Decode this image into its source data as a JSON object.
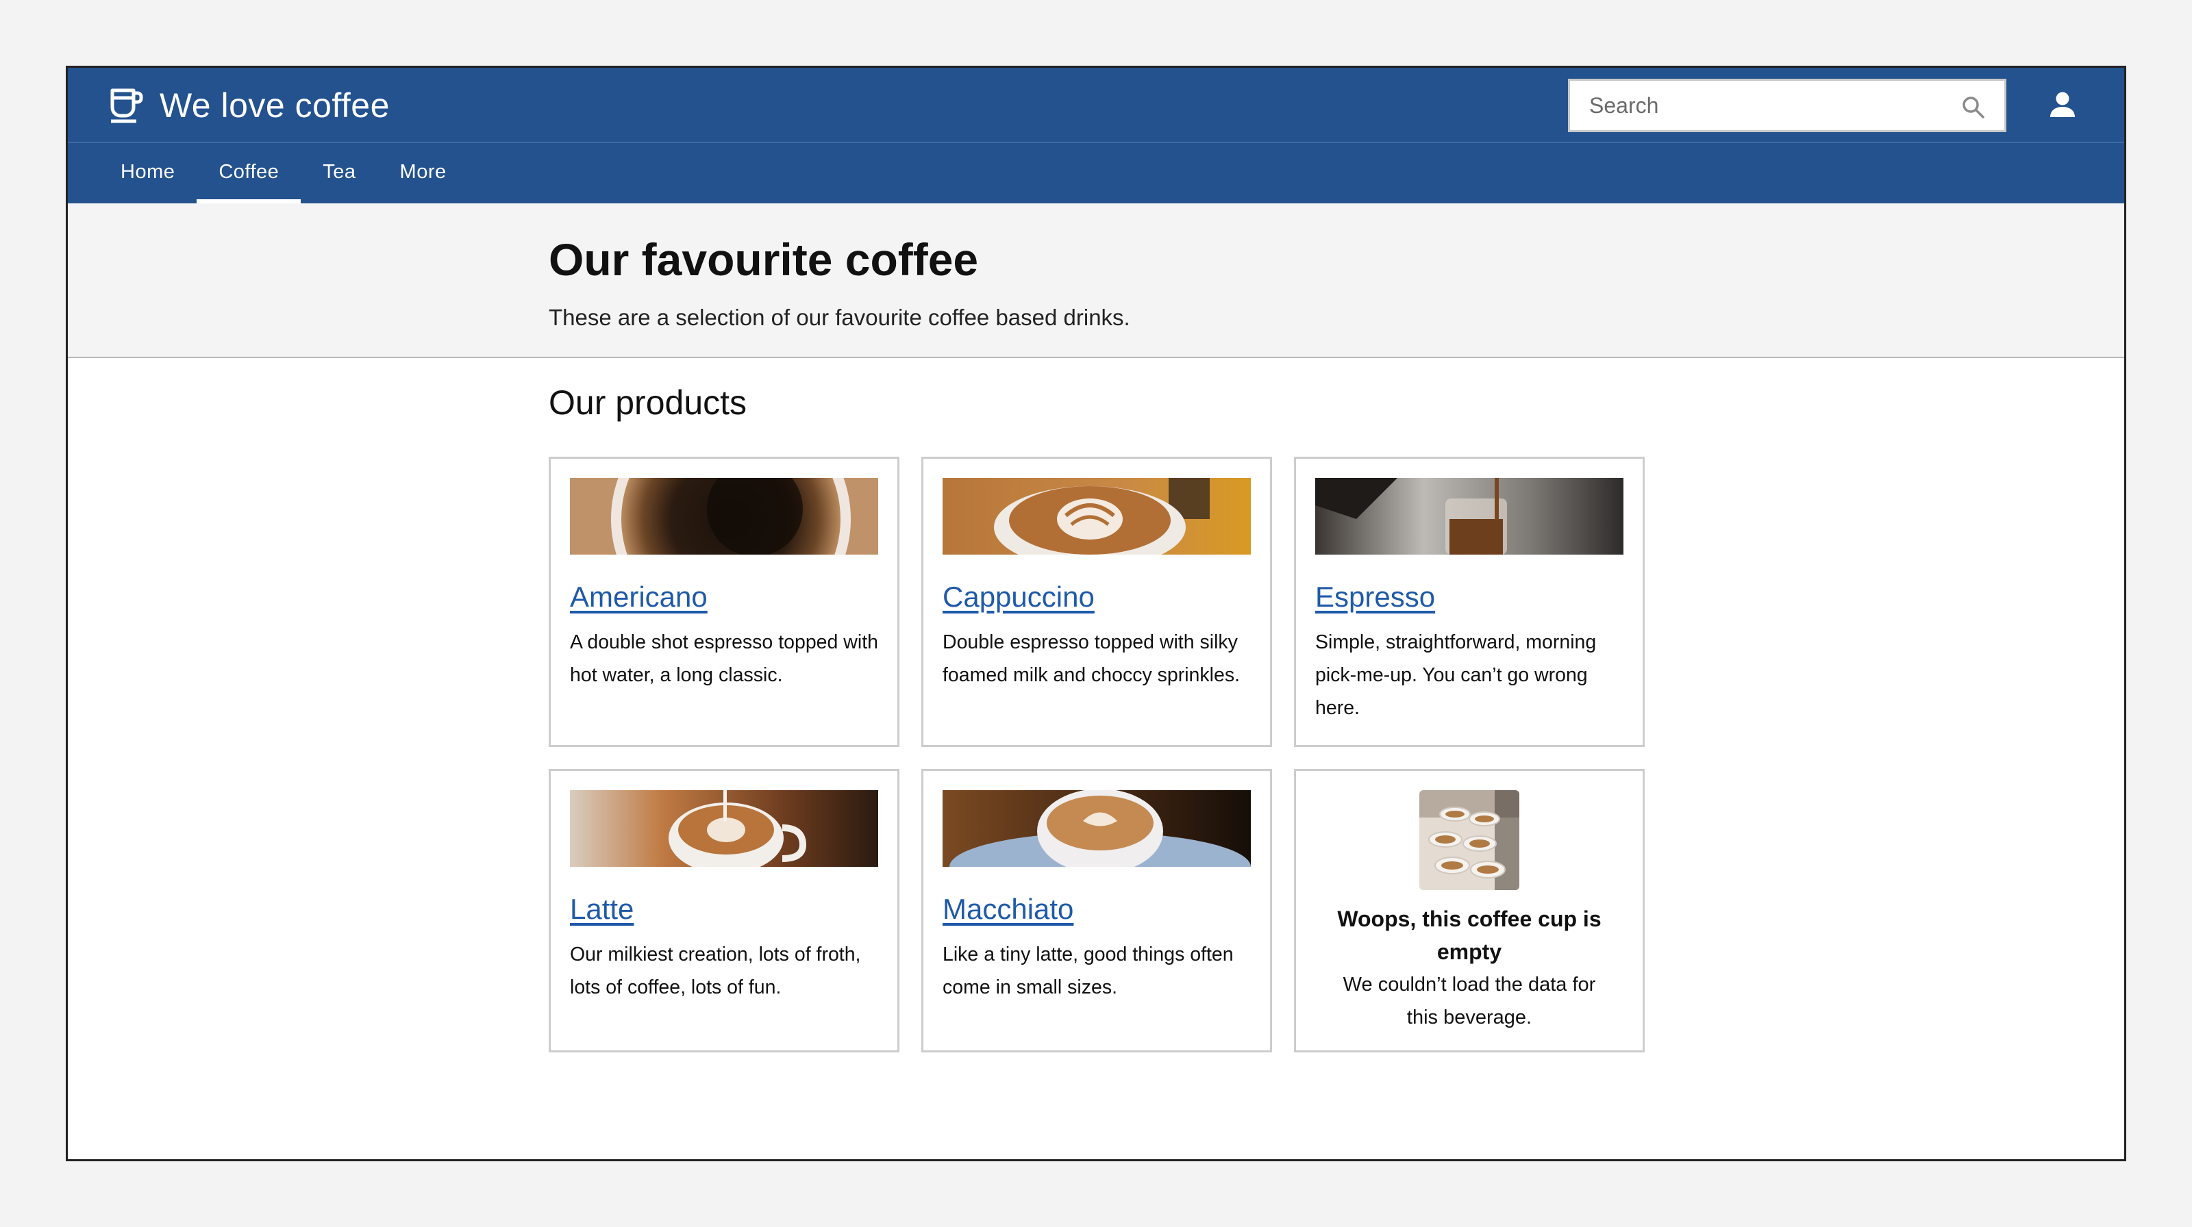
{
  "header": {
    "title": "We love coffee",
    "logo_icon": "coffee-cup-icon",
    "search_placeholder": "Search",
    "search_value": "",
    "user_icon": "user-icon"
  },
  "nav": {
    "items": [
      {
        "label": "Home",
        "active": false
      },
      {
        "label": "Coffee",
        "active": true
      },
      {
        "label": "Tea",
        "active": false
      },
      {
        "label": "More",
        "active": false
      }
    ]
  },
  "hero": {
    "title": "Our favourite coffee",
    "subtitle": "These are a selection of our favourite coffee based drinks."
  },
  "products": {
    "heading": "Our products",
    "items": [
      {
        "name": "Americano",
        "description": "A double shot espresso topped with hot water, a long classic."
      },
      {
        "name": "Cappuccino",
        "description": "Double espresso topped with silky foamed milk and choccy sprinkles."
      },
      {
        "name": "Espresso",
        "description": "Simple, straightforward, morning pick-me-up. You can’t go wrong here."
      },
      {
        "name": "Latte",
        "description": "Our milkiest creation, lots of froth, lots of coffee, lots of fun."
      },
      {
        "name": "Macchiato",
        "description": "Like a tiny latte, good things often come in small sizes."
      }
    ],
    "empty_state": {
      "title": "Woops, this coffee cup is empty",
      "description": "We couldn’t load the data for this beverage."
    }
  },
  "colors": {
    "brand": "#23528e",
    "link": "#1f5aa8",
    "hero_bg": "#f4f4f4"
  }
}
